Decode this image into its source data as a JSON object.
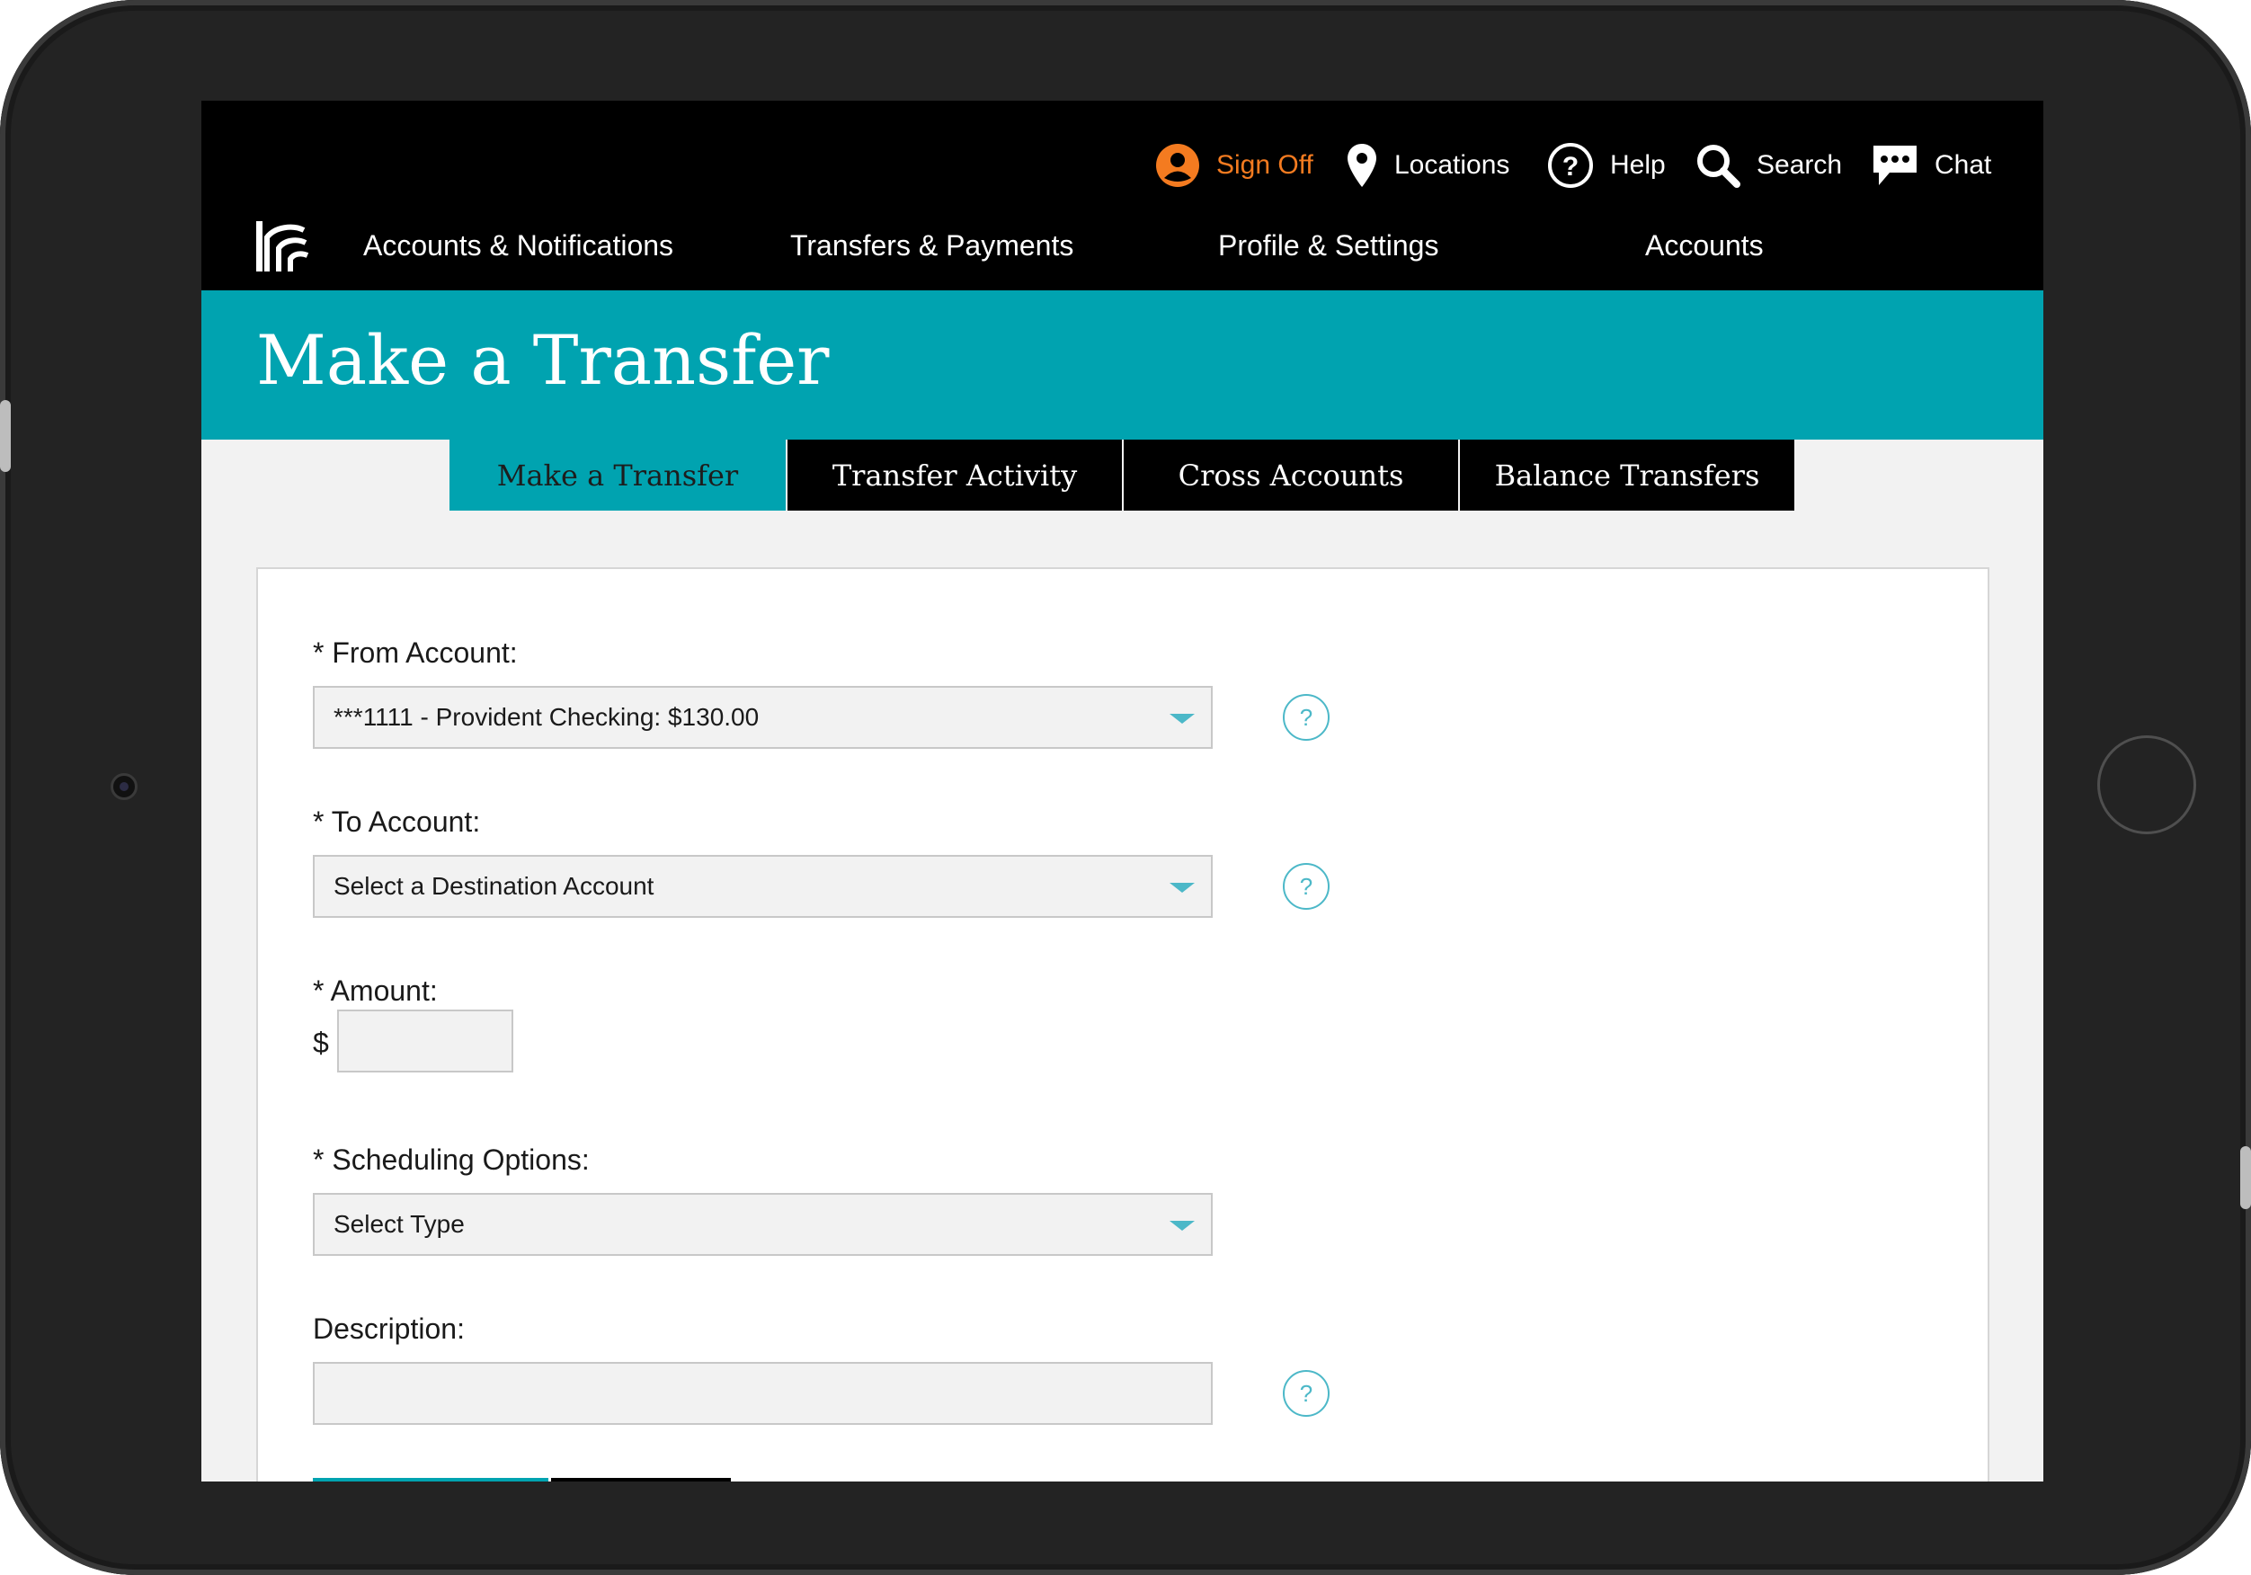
{
  "utility_nav": {
    "sign_off": "Sign Off",
    "locations": "Locations",
    "help": "Help",
    "search": "Search",
    "chat": "Chat"
  },
  "main_nav": {
    "items": [
      {
        "label": "Accounts & Notifications"
      },
      {
        "label": "Transfers & Payments"
      },
      {
        "label": "Profile & Settings"
      },
      {
        "label": "Accounts"
      }
    ]
  },
  "page": {
    "title": "Make a Transfer"
  },
  "tabs": [
    {
      "label": "Make a Transfer",
      "active": true
    },
    {
      "label": "Transfer Activity",
      "active": false
    },
    {
      "label": "Cross Accounts",
      "active": false
    },
    {
      "label": "Balance Transfers",
      "active": false
    }
  ],
  "form": {
    "from_account": {
      "label": "* From Account:",
      "value": "***1111 - Provident Checking: $130.00"
    },
    "to_account": {
      "label": "* To Account:",
      "value": "Select a Destination Account"
    },
    "amount": {
      "label": "* Amount:",
      "currency": "$",
      "value": ""
    },
    "scheduling": {
      "label": "* Scheduling Options:",
      "value": "Select Type"
    },
    "description": {
      "label": "Description:",
      "value": ""
    },
    "help_glyph": "?"
  },
  "colors": {
    "accent": "#00a3b0",
    "header_bg": "#000000",
    "sign_off": "#f47b20",
    "page_bg": "#f2f2f2"
  },
  "icons": {
    "sign_off": "user-circle-icon",
    "locations": "map-pin-icon",
    "help": "question-circle-icon",
    "search": "search-icon",
    "chat": "chat-bubble-icon",
    "logo": "brand-logo",
    "dropdown": "chevron-down-icon"
  }
}
